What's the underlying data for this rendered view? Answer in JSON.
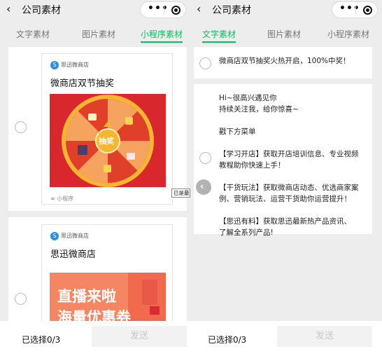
{
  "left_screen": {
    "header": {
      "back_icon": "chevron-left-icon",
      "title": "公司素材",
      "menu_icon": "more-dots-icon",
      "close_icon": "target-circle-icon"
    },
    "tabs": [
      {
        "label": "文字素材",
        "active": false
      },
      {
        "label": "图片素材",
        "active": false
      },
      {
        "label": "小程序素材",
        "active": true
      }
    ],
    "items": [
      {
        "source": "思迅微商店",
        "source_icon": "shop-logo-icon",
        "title": "微商店双节抽奖",
        "image_text": "抽奖",
        "image_icon": "prize-wheel-image",
        "footer": "小程序",
        "footer_icon": "link-icon"
      },
      {
        "source": "思迅微商店",
        "source_icon": "shop-logo-icon",
        "title": "思迅微商店",
        "image_line1": "直播来啦",
        "image_line2": "海量优惠券"
      }
    ],
    "tooltip": "已是最",
    "bottom": {
      "selected": "已选择0/3",
      "send": "发送"
    }
  },
  "right_screen": {
    "header": {
      "back_icon": "chevron-left-icon",
      "title": "公司素材",
      "menu_icon": "more-dots-icon",
      "close_icon": "target-circle-icon"
    },
    "tabs": [
      {
        "label": "文字素材",
        "active": true
      },
      {
        "label": "图片素材",
        "active": false
      },
      {
        "label": "小程序素材",
        "active": false
      }
    ],
    "items": [
      {
        "lines": [
          "微商店双节抽奖火热开启，100%中奖！"
        ]
      },
      {
        "lines": [
          "Hi~很高兴遇见你",
          "持续关注我，给你惊喜~",
          "",
          "戳下方菜单",
          "",
          "【学习开店】获取开店培训信息、专业视频",
          "教程助你快速上手！",
          "",
          "【干货玩法】获取微商店动态、优选商家案",
          "例、营销玩法、运营干货助你运营提升！",
          "",
          "【思迅有料】获取思迅最新热产品资讯、",
          "了解全系列产品!"
        ]
      }
    ],
    "scroll_button_icon": "chevron-left-icon",
    "bottom": {
      "selected": "已选择0/3",
      "send": "发送"
    }
  },
  "colors": {
    "accent_green": "#07c160",
    "background": "#ededed",
    "wheel_red": "#d9272e",
    "promo_orange": "#f48663"
  }
}
